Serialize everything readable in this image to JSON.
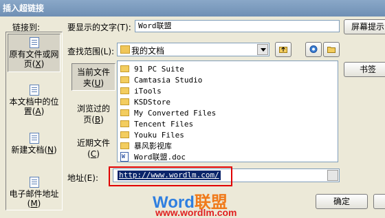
{
  "window": {
    "title": "插入超链接"
  },
  "left": {
    "label": "链接到:",
    "items": [
      {
        "label1": "原有文件或网",
        "label2": "页",
        "key": "X"
      },
      {
        "label1": "本文档中的位",
        "label2": "置",
        "key": "A"
      },
      {
        "label1": "新建文档",
        "label2": "",
        "key": "N"
      },
      {
        "label1": "电子邮件地址",
        "label2": "",
        "key": "M"
      }
    ]
  },
  "display_text": {
    "label": "要显示的文字(T):",
    "value": "Word联盟"
  },
  "screen_tip_button": "屏幕提示",
  "lookin": {
    "label": "查找范围(L):",
    "value": "我的文档"
  },
  "bookmark_button": "书签",
  "nav": {
    "items": [
      {
        "l1": "当前文件",
        "l2": "夹",
        "key": "U"
      },
      {
        "l1": "浏览过的",
        "l2": "页",
        "key": "B"
      },
      {
        "l1": "近期文件",
        "l2": "",
        "key": "C"
      }
    ]
  },
  "files": [
    "91 PC Suite",
    "Camtasia Studio",
    "iTools",
    "KSDStore",
    "My Converted Files",
    "Tencent Files",
    "Youku Files",
    "暴风影视库",
    "Word联盟.doc"
  ],
  "address": {
    "label": "地址(E):",
    "value": "http://www.wordlm.com/"
  },
  "ok_button": "确定",
  "watermark": {
    "brand_a": "Word",
    "brand_b": "联盟",
    "url": "www.wordlm.com"
  }
}
